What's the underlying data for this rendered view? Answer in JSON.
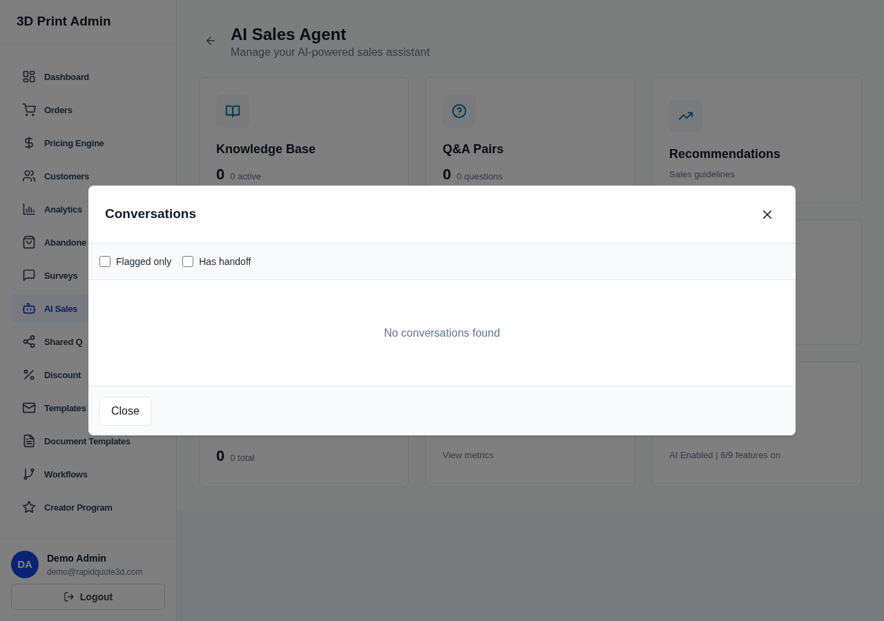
{
  "sidebar": {
    "brand": "3D Print Admin",
    "nav": [
      {
        "label": "Dashboard",
        "selected": false
      },
      {
        "label": "Orders",
        "selected": false
      },
      {
        "label": "Pricing Engine",
        "selected": false
      },
      {
        "label": "Customers",
        "selected": false
      },
      {
        "label": "Analytics",
        "selected": false
      },
      {
        "label": "Abandone",
        "selected": false
      },
      {
        "label": "Surveys",
        "selected": false
      },
      {
        "label": "AI Sales",
        "selected": true
      },
      {
        "label": "Shared Q",
        "selected": false
      },
      {
        "label": "Discount",
        "selected": false
      },
      {
        "label": "Templates",
        "selected": false
      },
      {
        "label": "Document Templates",
        "selected": false
      },
      {
        "label": "Workflows",
        "selected": false
      },
      {
        "label": "Creator Program",
        "selected": false
      }
    ],
    "user": {
      "initials": "DA",
      "name": "Demo Admin",
      "email": "demo@rapidquote3d.com"
    },
    "logout": "Logout"
  },
  "page": {
    "title": "AI Sales Agent",
    "subtitle": "Manage your AI-powered sales assistant"
  },
  "cards_top": [
    {
      "kind": "count",
      "title": "Knowledge Base",
      "value": "0",
      "note": "0 active"
    },
    {
      "kind": "count",
      "title": "Q&A Pairs",
      "value": "0",
      "note": "0 questions"
    },
    {
      "kind": "text",
      "title": "Recommendations",
      "subtitle": "Sales guidelines"
    }
  ],
  "cards_bottom": [
    {
      "kind": "count",
      "value": "0",
      "note": "0 total"
    },
    {
      "kind": "text",
      "subtitle": "View metrics"
    },
    {
      "kind": "text",
      "subtitle": "AI Enabled | 6/9 features on"
    }
  ],
  "modal": {
    "title": "Conversations",
    "filters": [
      {
        "label": "Flagged only",
        "checked": false
      },
      {
        "label": "Has handoff",
        "checked": false
      }
    ],
    "empty": "No conversations found",
    "close": "Close"
  }
}
